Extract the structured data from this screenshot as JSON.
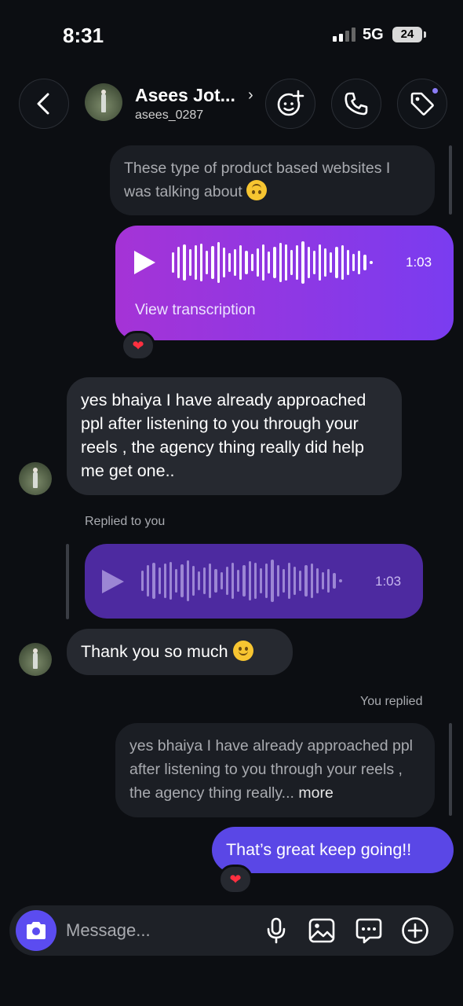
{
  "status": {
    "time": "8:31",
    "network": "5G",
    "battery": "24"
  },
  "header": {
    "name": "Asees Jot...",
    "username": "asees_0287"
  },
  "messages": {
    "reply_preview_1": "These type of product based websites I was talking about",
    "voice_outgoing": {
      "duration": "1:03",
      "transcription_label": "View transcription",
      "reaction": "❤"
    },
    "incoming_1": "yes bhaiya I have already approached ppl after listening to you through your reels , the agency thing really did help me get one..",
    "replied_to_you_label": "Replied to you",
    "voice_quoted": {
      "duration": "1:03"
    },
    "incoming_2": "Thank you so much",
    "you_replied_label": "You replied",
    "reply_preview_2": "yes bhaiya I have already approached ppl after listening to you through your reels , the agency thing really...",
    "more_label": "more",
    "outgoing_1": "That’s great keep going!!",
    "outgoing_1_reaction": "❤"
  },
  "composer": {
    "placeholder": "Message..."
  },
  "colors": {
    "accent": "#5a47e6",
    "voice_gradient_start": "#a533d6",
    "voice_gradient_end": "#7a3cf0",
    "quoted_voice": "#4d2aa0",
    "reaction": "#ff3040"
  },
  "icons": {
    "back": "chevron-left-icon",
    "effects": "face-sparkle-icon",
    "call": "phone-icon",
    "tag": "tag-icon",
    "camera": "camera-icon",
    "mic": "microphone-icon",
    "gallery": "image-icon",
    "sticker": "chat-bubble-icon",
    "add": "plus-circle-icon"
  }
}
